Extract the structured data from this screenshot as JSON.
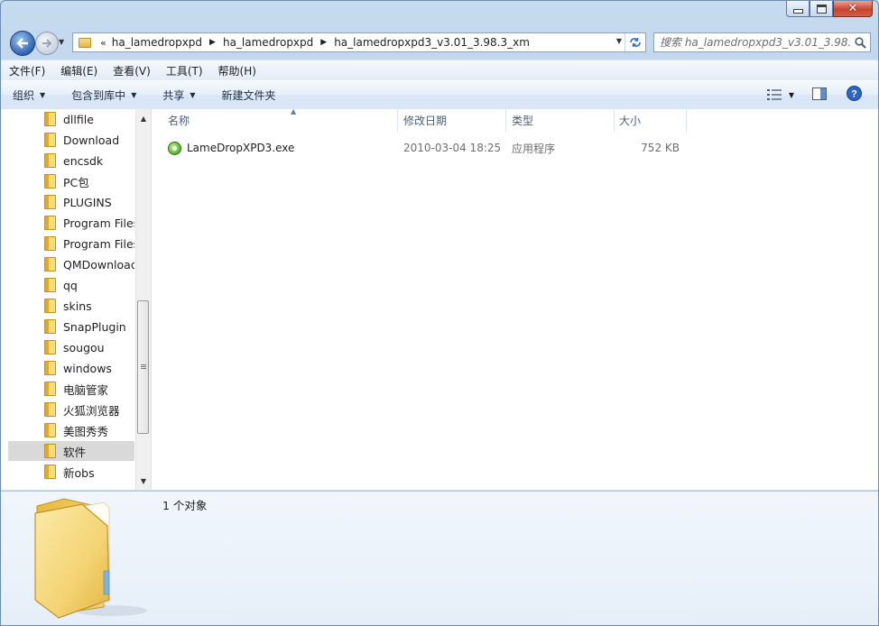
{
  "window": {
    "minimize_icon": "minimize-icon",
    "maximize_icon": "maximize-icon",
    "close_icon": "close-icon"
  },
  "address": {
    "overflow": "«",
    "crumbs": [
      "ha_lamedropxpd",
      "ha_lamedropxpd",
      "ha_lamedropxpd3_v3.01_3.98.3_xm"
    ]
  },
  "search": {
    "placeholder": "搜索 ha_lamedropxpd3_v3.01_3.98..."
  },
  "menu": [
    "文件(F)",
    "编辑(E)",
    "查看(V)",
    "工具(T)",
    "帮助(H)"
  ],
  "toolbar": {
    "organize": "组织",
    "include_in_library": "包含到库中",
    "share": "共享",
    "new_folder": "新建文件夹"
  },
  "nav": {
    "items": [
      "dllfile",
      "Download",
      "encsdk",
      "PC包",
      "PLUGINS",
      "Program Files",
      "Program Files",
      "QMDownload",
      "qq",
      "skins",
      "SnapPlugin",
      "sougou",
      "windows",
      "电脑管家",
      "火狐浏览器",
      "美图秀秀",
      "软件",
      "新obs"
    ],
    "selected": "软件"
  },
  "columns": {
    "name": "名称",
    "date": "修改日期",
    "type": "类型",
    "size": "大小"
  },
  "files": [
    {
      "name": "LameDropXPD3.exe",
      "date": "2010-03-04 18:25",
      "type": "应用程序",
      "size": "752 KB",
      "icon": "exe-app-icon"
    }
  ],
  "details": {
    "count": "1 个对象"
  },
  "colors": {
    "accent": "#2f63b6",
    "folder": "#f3d46a",
    "selected_row": "#d9d9d9"
  }
}
